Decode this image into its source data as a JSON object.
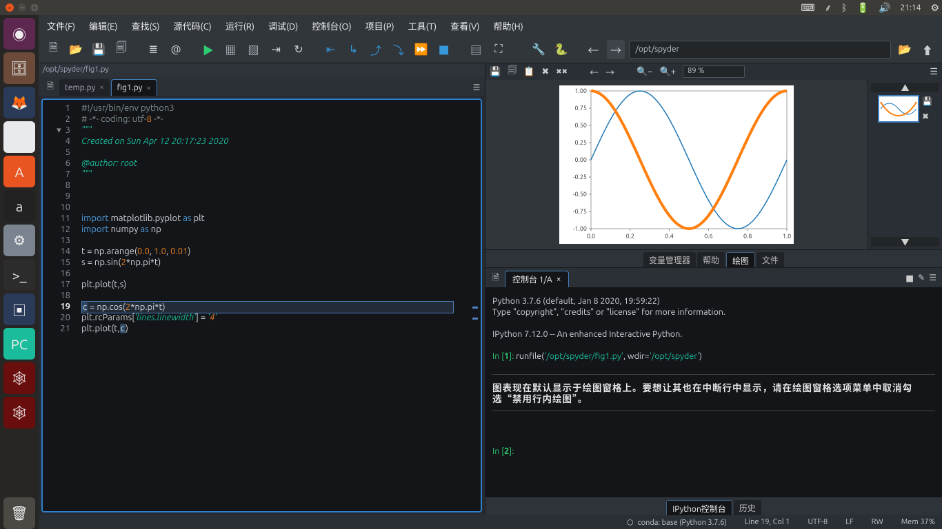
{
  "system": {
    "time": "21:14",
    "launcher": [
      {
        "name": "dash",
        "bg": "#5e2750",
        "glyph": "◉"
      },
      {
        "name": "files",
        "bg": "#6b4a3a",
        "glyph": "🗄"
      },
      {
        "name": "firefox",
        "bg": "#2a3b5a",
        "glyph": "🦊"
      },
      {
        "name": "chrome",
        "bg": "#e8eaed",
        "glyph": "◯"
      },
      {
        "name": "software",
        "bg": "#e95420",
        "glyph": "A"
      },
      {
        "name": "amazon",
        "bg": "#222",
        "glyph": "a"
      },
      {
        "name": "settings",
        "bg": "#7a8490",
        "glyph": "⚙"
      },
      {
        "name": "terminal",
        "bg": "#2c2c2c",
        "glyph": ">_"
      },
      {
        "name": "vbox",
        "bg": "#2a3b5a",
        "glyph": "▣"
      },
      {
        "name": "pycharm",
        "bg": "#1bbc9b",
        "glyph": "PC"
      },
      {
        "name": "spyder1",
        "bg": "#6a0d0d",
        "glyph": "🕸"
      },
      {
        "name": "spyder2",
        "bg": "#6a0d0d",
        "glyph": "🕸"
      },
      {
        "name": "trash",
        "bg": "#4a4944",
        "glyph": "🗑"
      }
    ]
  },
  "menu": {
    "file": "文件(F)",
    "edit": "编辑(E)",
    "search": "查找(S)",
    "source": "源代码(C)",
    "run": "运行(R)",
    "debug": "调试(D)",
    "consoles": "控制台(O)",
    "projects": "项目(P)",
    "tools": "工具(T)",
    "view": "查看(V)",
    "help": "帮助(H)"
  },
  "toolbar": {
    "cwd": "/opt/spyder"
  },
  "editor": {
    "filepath": "/opt/spyder/fig1.py",
    "tabs": [
      {
        "name": "temp.py",
        "active": false
      },
      {
        "name": "fig1.py",
        "active": true
      }
    ],
    "lines": [
      "#!/usr/bin/env python3",
      "# -*- coding: utf-8 -*-",
      "\"\"\"",
      "Created on Sun Apr 12 20:17:23 2020",
      "",
      "@author: root",
      "\"\"\"",
      "",
      "",
      "",
      "import matplotlib.pyplot as plt",
      "import numpy as np",
      "",
      "t = np.arange(0.0, 1.0, 0.01)",
      "s = np.sin(2*np.pi*t)",
      "",
      "plt.plot(t,s)",
      "",
      "c = np.cos(2*np.pi*t)",
      "plt.rcParams['lines.linewidth'] = '4'",
      "plt.plot(t,c)"
    ],
    "current_line": 19
  },
  "plots": {
    "zoom": "89 %",
    "tabs": {
      "var": "变量管理器",
      "help": "帮助",
      "plots": "绘图",
      "files": "文件"
    }
  },
  "chart_data": {
    "type": "line",
    "x": [
      0.0,
      0.2,
      0.4,
      0.6,
      0.8,
      1.0
    ],
    "xlim": [
      0.0,
      1.0
    ],
    "ylim": [
      -1.0,
      1.0
    ],
    "yticks": [
      -1.0,
      -0.75,
      -0.5,
      -0.25,
      0.0,
      0.25,
      0.5,
      0.75,
      1.0
    ],
    "series": [
      {
        "name": "sin(2πt)",
        "color": "#1f77b4",
        "linewidth": 1.5,
        "fn": "sin"
      },
      {
        "name": "cos(2πt)",
        "color": "#ff7f0e",
        "linewidth": 4,
        "fn": "cos"
      }
    ]
  },
  "console": {
    "tab": "控制台 1/A",
    "py_version": "Python 3.7.6 (default, Jan  8 2020, 19:59:22)",
    "py_hint": "Type \"copyright\", \"credits\" or \"license\" for more information.",
    "ipy_version": "IPython 7.12.0 -- An enhanced Interactive Python.",
    "in1_prefix": "In [",
    "in1_n": "1",
    "in1_suffix": "]: ",
    "runfile_cmd": "runfile(",
    "runfile_path": "'/opt/spyder/fig1.py'",
    "runfile_mid": ", wdir=",
    "runfile_wdir": "'/opt/spyder'",
    "runfile_end": ")",
    "hint": "图表现在默认显示于绘图窗格上。要想让其也在中断行中显示，请在绘图窗格选项菜单中取消勾选“禁用行内绘图”。",
    "in2_n": "2",
    "bottom_tabs": {
      "ipy": "IPython控制台",
      "hist": "历史"
    }
  },
  "status": {
    "env": "conda: base (Python 3.7.6)",
    "pos": "Line 19, Col 1",
    "enc": "UTF-8",
    "eol": "LF",
    "rw": "RW",
    "mem": "Mem 37%"
  }
}
